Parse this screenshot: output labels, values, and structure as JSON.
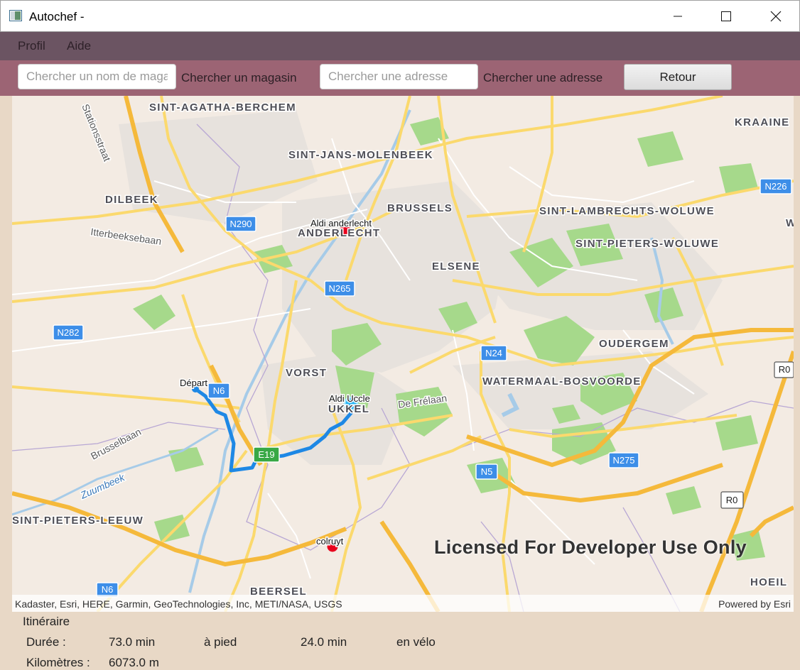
{
  "window": {
    "title": "Autochef -"
  },
  "menu": {
    "items": [
      "Profil",
      "Aide"
    ]
  },
  "toolbar": {
    "shop_search_placeholder": "Chercher un nom de magasin",
    "shop_search_label": "Chercher un magasin",
    "address_search_placeholder": "Chercher une adresse",
    "address_search_label": "Chercher une adresse",
    "back_button": "Retour"
  },
  "map": {
    "places": {
      "sint_agatha_berchem": "SINT-AGATHA-BERCHEM",
      "sint_jans_molenbeek": "SINT-JANS-MOLENBEEK",
      "kraainem": "KRAAINE",
      "dilbeek": "DILBEEK",
      "brussels": "BRUSSELS",
      "sint_lambrechts_woluwe": "SINT-LAMBRECHTS-WOLUWE",
      "anderlecht": "ANDERLECHT",
      "sint_pieters_woluwe": "SINT-PIETERS-WOLUWE",
      "elsene": "ELSENE",
      "oudergem": "OUDERGEM",
      "vorst": "VORST",
      "watermaal_bosvoorde": "WATERMAAL-BOSVOORDE",
      "ukkel": "UKKEL",
      "sint_pieters_leeuw": "SINT-PIETERS-LEEUW",
      "beersel": "BEERSEL",
      "hoeilaart": "HOEIL",
      "w_edge": "W"
    },
    "streets": {
      "stationsstraat": "Stationsstraat",
      "itterbeeksebaan": "Itterbeeksebaan",
      "brusselbaan": "Brusselbaan",
      "zuumbeek": "Zuumbeek",
      "de_frelaan": "De Frélaan"
    },
    "shields": {
      "n290": "N290",
      "n265": "N265",
      "n282": "N282",
      "n24": "N24",
      "n6": "N6",
      "e19": "E19",
      "n5": "N5",
      "n275": "N275",
      "r0_a": "R0",
      "r0_b": "R0",
      "n226": "N226",
      "n6_b": "N6"
    },
    "markers": {
      "aldi_anderlecht": "Aldi anderlecht",
      "depart": "Départ",
      "aldi_uccle": "Aldi Uccle",
      "colruyt": "colruyt"
    },
    "attribution": "Kadaster, Esri, HERE, Garmin, GeoTechnologies, Inc, METI/NASA, USGS",
    "powered_by": "Powered by Esri",
    "watermark": "Licensed For Developer Use Only",
    "colors": {
      "route": "#1e88e5",
      "store_marker": "#e8001c",
      "destination_marker": "#29b6f6"
    }
  },
  "itinerary": {
    "heading": "Itinéraire",
    "duration_label": "Durée :",
    "walk_time": "73.0 min",
    "walk_label": "à pied",
    "bike_time": "24.0 min",
    "bike_label": "en vélo",
    "distance_label": "Kilomètres :",
    "distance_value": "6073.0 m"
  }
}
